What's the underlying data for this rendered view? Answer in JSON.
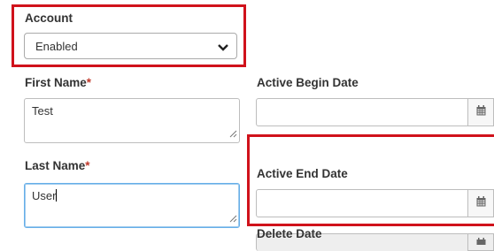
{
  "account": {
    "label": "Account",
    "selected": "Enabled",
    "chevron_icon": "chevron-down-icon"
  },
  "first_name": {
    "label": "First Name",
    "required_mark": "*",
    "value": "Test"
  },
  "last_name": {
    "label": "Last Name",
    "required_mark": "*",
    "value": "User"
  },
  "active_begin_date": {
    "label": "Active Begin Date",
    "value": "",
    "icon": "calendar-icon"
  },
  "active_end_date": {
    "label": "Active End Date",
    "value": "",
    "icon": "calendar-icon"
  },
  "delete_date": {
    "label": "Delete Date",
    "value": "",
    "icon": "calendar-icon"
  },
  "colors": {
    "highlight": "#d0121b",
    "required": "#c0392b",
    "focus": "#66afe9"
  }
}
